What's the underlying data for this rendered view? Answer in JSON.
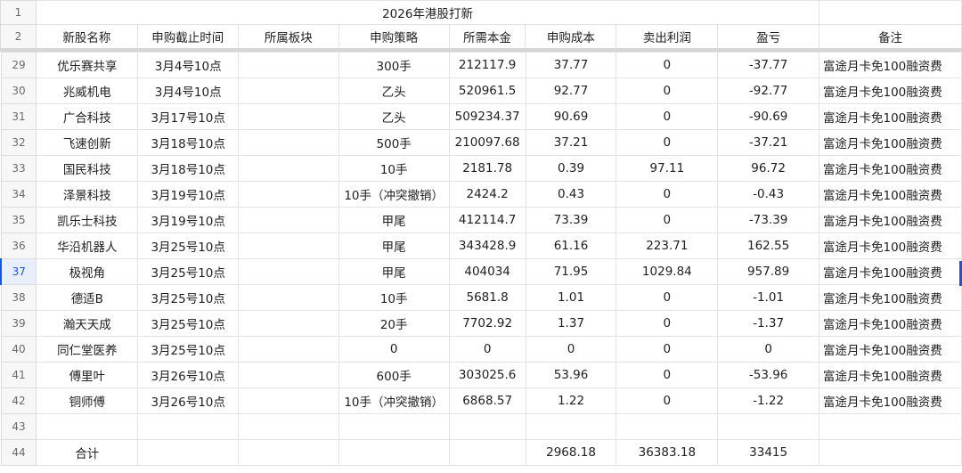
{
  "sheet": {
    "title": "2026年港股打新",
    "headers": [
      "新股名称",
      "申购截止时间",
      "所属板块",
      "申购策略",
      "所需本金",
      "申购成本",
      "卖出利润",
      "盈亏",
      "备注"
    ],
    "header_row_numbers": [
      "1",
      "2"
    ],
    "rows": [
      {
        "rn": "29",
        "name": "优乐赛共享",
        "deadline": "3月4号10点",
        "sector": "",
        "strategy": "300手",
        "capital": "212117.9",
        "cost": "37.77",
        "profit": "0",
        "pnl": "-37.77",
        "note": "富途月卡免100融资费"
      },
      {
        "rn": "30",
        "name": "兆威机电",
        "deadline": "3月4号10点",
        "sector": "",
        "strategy": "乙头",
        "capital": "520961.5",
        "cost": "92.77",
        "profit": "0",
        "pnl": "-92.77",
        "note": "富途月卡免100融资费"
      },
      {
        "rn": "31",
        "name": "广合科技",
        "deadline": "3月17号10点",
        "sector": "",
        "strategy": "乙头",
        "capital": "509234.37",
        "cost": "90.69",
        "profit": "0",
        "pnl": "-90.69",
        "note": "富途月卡免100融资费"
      },
      {
        "rn": "32",
        "name": "飞速创新",
        "deadline": "3月18号10点",
        "sector": "",
        "strategy": "500手",
        "capital": "210097.68",
        "cost": "37.21",
        "profit": "0",
        "pnl": "-37.21",
        "note": "富途月卡免100融资费"
      },
      {
        "rn": "33",
        "name": "国民科技",
        "deadline": "3月18号10点",
        "sector": "",
        "strategy": "10手",
        "capital": "2181.78",
        "cost": "0.39",
        "profit": "97.11",
        "pnl": "96.72",
        "note": "富途月卡免100融资费"
      },
      {
        "rn": "34",
        "name": "泽景科技",
        "deadline": "3月19号10点",
        "sector": "",
        "strategy": "10手（冲突撤销）",
        "capital": "2424.2",
        "cost": "0.43",
        "profit": "0",
        "pnl": "-0.43",
        "note": "富途月卡免100融资费"
      },
      {
        "rn": "35",
        "name": "凯乐士科技",
        "deadline": "3月19号10点",
        "sector": "",
        "strategy": "甲尾",
        "capital": "412114.7",
        "cost": "73.39",
        "profit": "0",
        "pnl": "-73.39",
        "note": "富途月卡免100融资费"
      },
      {
        "rn": "36",
        "name": "华沿机器人",
        "deadline": "3月25号10点",
        "sector": "",
        "strategy": "甲尾",
        "capital": "343428.9",
        "cost": "61.16",
        "profit": "223.71",
        "pnl": "162.55",
        "note": "富途月卡免100融资费"
      },
      {
        "rn": "37",
        "name": "极视角",
        "deadline": "3月25号10点",
        "sector": "",
        "strategy": "甲尾",
        "capital": "404034",
        "cost": "71.95",
        "profit": "1029.84",
        "pnl": "957.89",
        "note": "富途月卡免100融资费"
      },
      {
        "rn": "38",
        "name": "德适B",
        "deadline": "3月25号10点",
        "sector": "",
        "strategy": "10手",
        "capital": "5681.8",
        "cost": "1.01",
        "profit": "0",
        "pnl": "-1.01",
        "note": "富途月卡免100融资费"
      },
      {
        "rn": "39",
        "name": "瀚天天成",
        "deadline": "3月25号10点",
        "sector": "",
        "strategy": "20手",
        "capital": "7702.92",
        "cost": "1.37",
        "profit": "0",
        "pnl": "-1.37",
        "note": "富途月卡免100融资费"
      },
      {
        "rn": "40",
        "name": "同仁堂医养",
        "deadline": "3月25号10点",
        "sector": "",
        "strategy": "0",
        "capital": "0",
        "cost": "0",
        "profit": "0",
        "pnl": "0",
        "note": "富途月卡免100融资费"
      },
      {
        "rn": "41",
        "name": "傅里叶",
        "deadline": "3月26号10点",
        "sector": "",
        "strategy": "600手",
        "capital": "303025.6",
        "cost": "53.96",
        "profit": "0",
        "pnl": "-53.96",
        "note": "富途月卡免100融资费"
      },
      {
        "rn": "42",
        "name": "铜师傅",
        "deadline": "3月26号10点",
        "sector": "",
        "strategy": "10手（冲突撤销）",
        "capital": "6868.57",
        "cost": "1.22",
        "profit": "0",
        "pnl": "-1.22",
        "note": "富途月卡免100融资费"
      },
      {
        "rn": "43",
        "name": "",
        "deadline": "",
        "sector": "",
        "strategy": "",
        "capital": "",
        "cost": "",
        "profit": "",
        "pnl": "",
        "note": ""
      },
      {
        "rn": "44",
        "name": "合计",
        "deadline": "",
        "sector": "",
        "strategy": "",
        "capital": "",
        "cost": "2968.18",
        "profit": "36383.18",
        "pnl": "33415",
        "note": ""
      }
    ],
    "selected_row": "37"
  }
}
